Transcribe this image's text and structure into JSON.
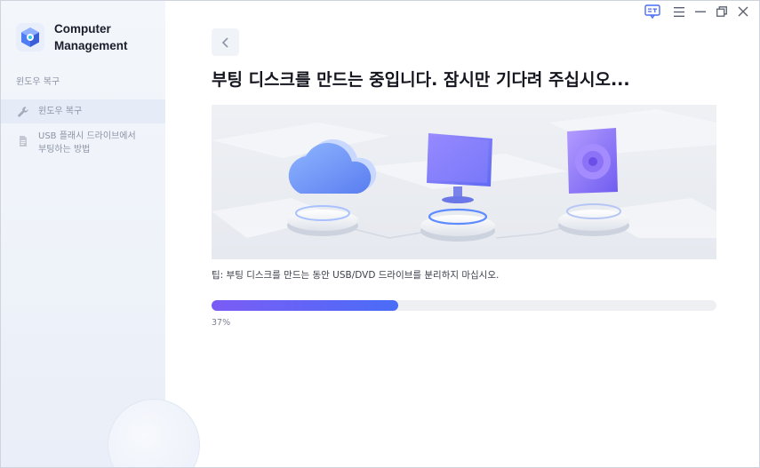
{
  "app": {
    "name": "Computer\nManagement"
  },
  "sidebar": {
    "section_title": "윈도우 복구",
    "items": [
      {
        "label": "윈도우 복구",
        "icon": "wrench-icon",
        "active": true
      },
      {
        "label": "USB 플래시 드라이브에서\n부팅하는 방법",
        "icon": "document-icon",
        "active": false
      }
    ]
  },
  "titlebar": {
    "icons": [
      "feedback-icon",
      "menu-icon",
      "minimize-icon",
      "restore-icon",
      "close-icon"
    ]
  },
  "main": {
    "title": "부팅 디스크를 만드는 중입니다. 잠시만 기다려 주십시오...",
    "tip": "팁: 부팅 디스크를 만드는 동안 USB/DVD 드라이브를 분리하지 마십시오.",
    "progress": {
      "value": 0.37,
      "label": "37%"
    }
  },
  "colors": {
    "accent_start": "#7b5cf5",
    "accent_end": "#4a6cf7",
    "sidebar_bg": "#eef2f9"
  }
}
